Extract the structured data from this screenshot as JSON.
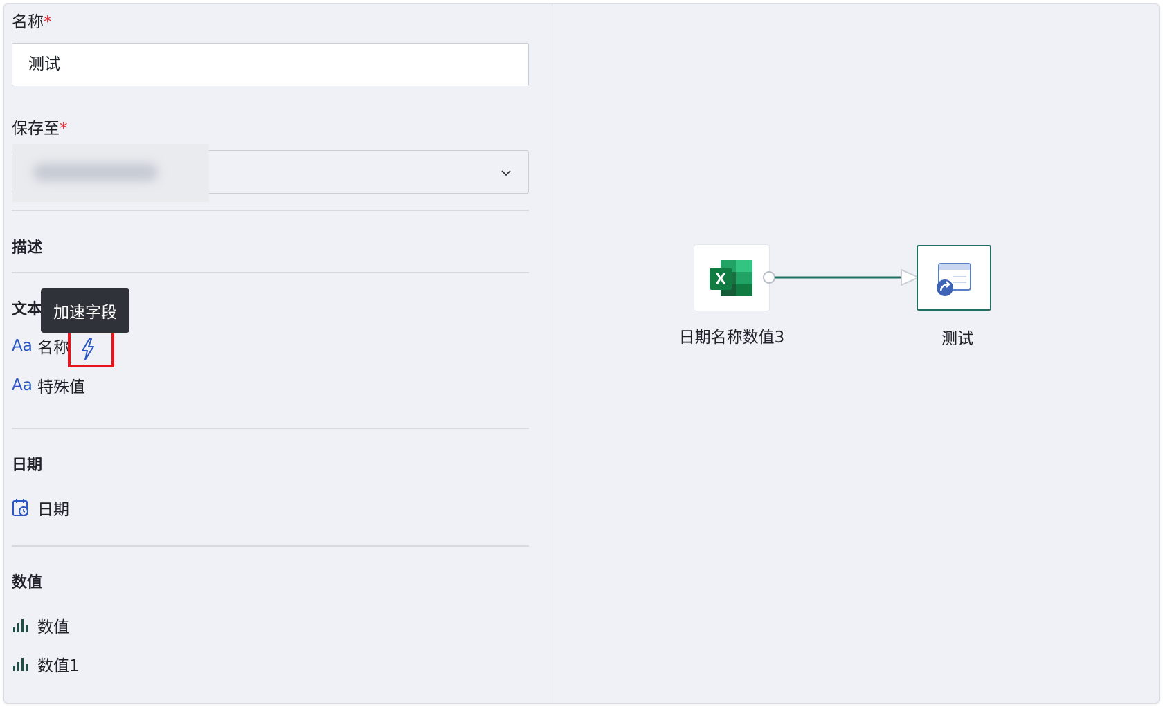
{
  "form": {
    "name_label": "名称",
    "name_required": "*",
    "name_value": "测试",
    "save_label": "保存至",
    "save_required": "*",
    "description_label": "描述"
  },
  "tooltip": {
    "text": "加速字段"
  },
  "sections": {
    "text": {
      "title": "文本",
      "fields": [
        {
          "icon": "text-type-icon",
          "type_label": "Aa",
          "name": "名称"
        },
        {
          "icon": "text-type-icon",
          "type_label": "Aa",
          "name": "特殊值"
        }
      ]
    },
    "date": {
      "title": "日期",
      "fields": [
        {
          "icon": "calendar-icon",
          "name": "日期"
        }
      ]
    },
    "number": {
      "title": "数值",
      "fields": [
        {
          "icon": "bar-chart-icon",
          "name": "数值"
        },
        {
          "icon": "bar-chart-icon",
          "name": "数值1"
        }
      ]
    }
  },
  "flow": {
    "source_node": {
      "icon": "excel-icon",
      "label": "日期名称数值3"
    },
    "target_node": {
      "icon": "dataset-icon",
      "label": "测试"
    }
  },
  "colors": {
    "accent_blue": "#2a56c6",
    "required_red": "#e02b2b",
    "connector_teal": "#1f6f63",
    "highlight_red": "#e8141c"
  }
}
